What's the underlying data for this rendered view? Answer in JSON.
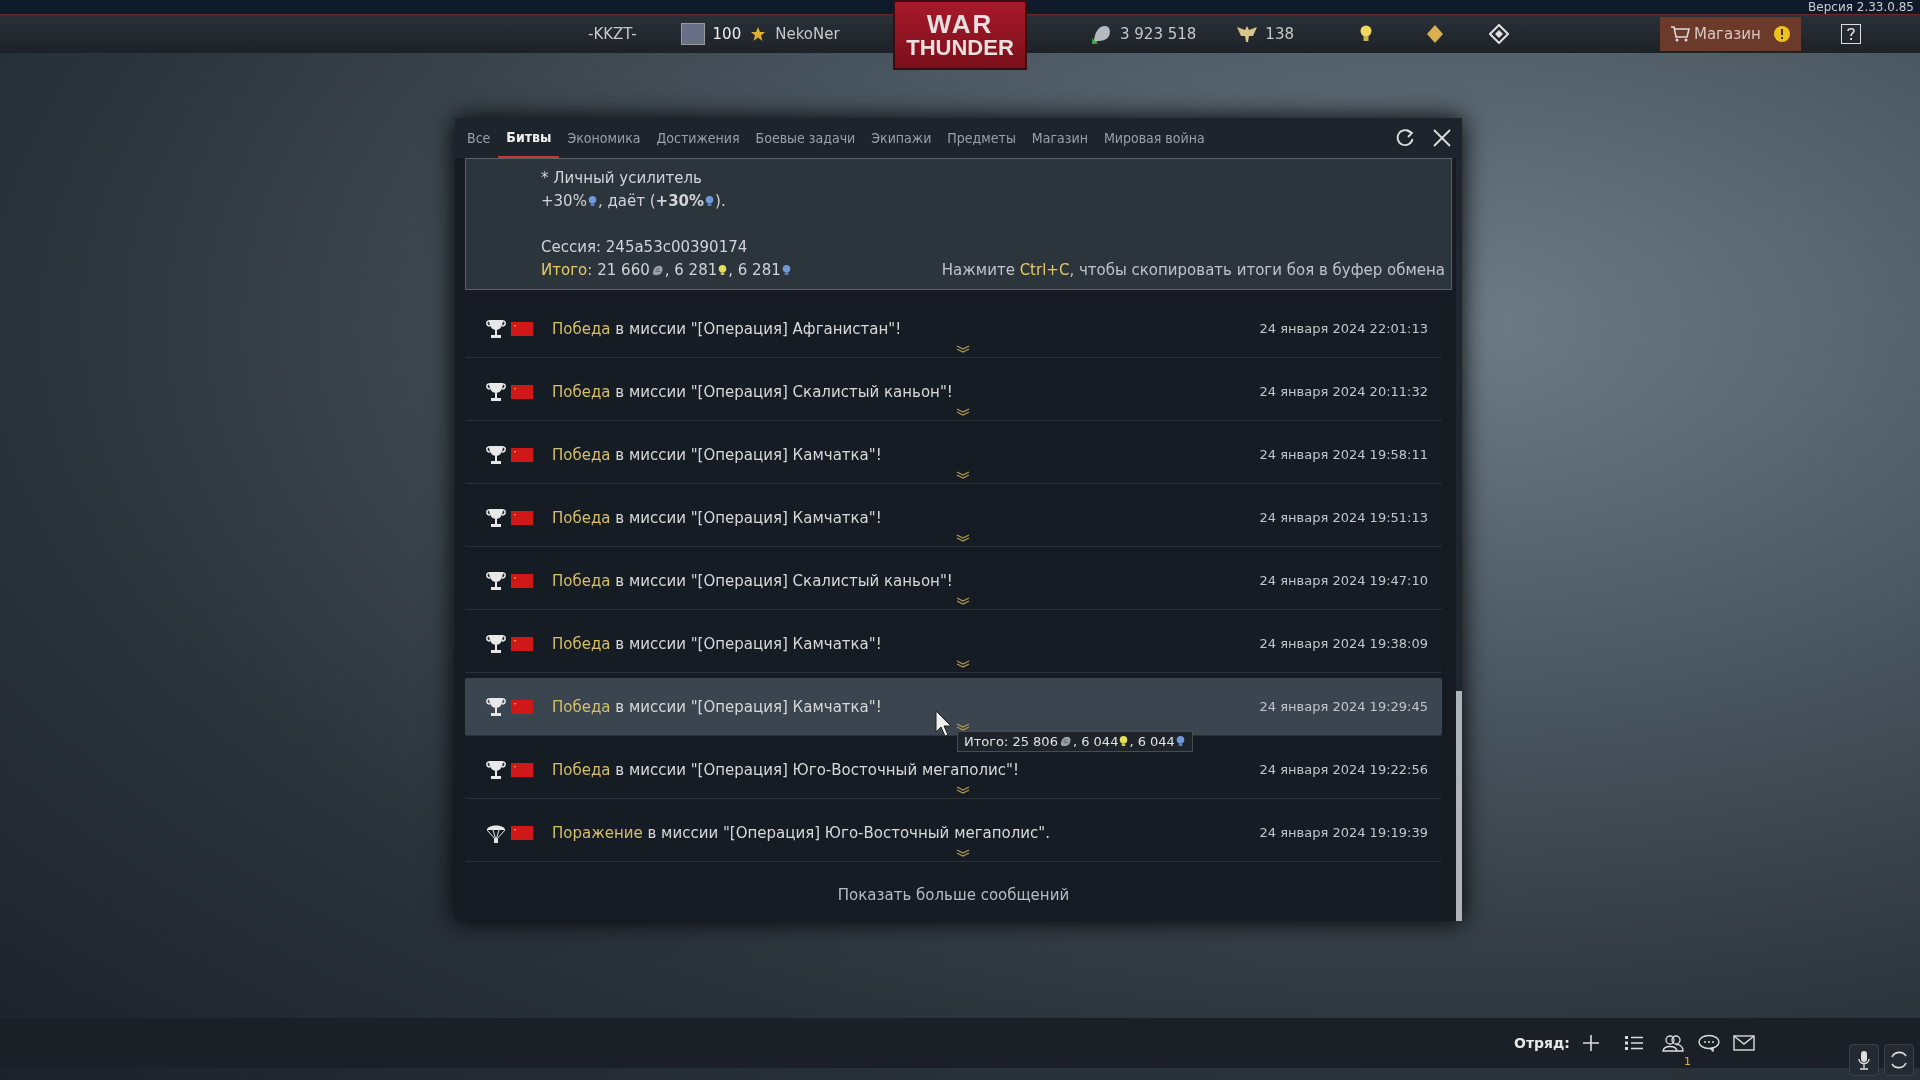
{
  "top_bar": {
    "version": "Версия 2.33.0.85",
    "clan_tag": "-KKZT-",
    "rank": "100",
    "nickname": "NekoNer",
    "logo": {
      "line_1": "WAR",
      "line_2": "THUNDER"
    },
    "silver": "3 923 518",
    "gold": "138",
    "shop": "Магазин"
  },
  "dialog": {
    "tabs": [
      {
        "label": "Все",
        "selected": false
      },
      {
        "label": "Битвы",
        "selected": true
      },
      {
        "label": "Экономика",
        "selected": false
      },
      {
        "label": "Достижения",
        "selected": false
      },
      {
        "label": "Боевые задачи",
        "selected": false
      },
      {
        "label": "Экипажи",
        "selected": false
      },
      {
        "label": "Предметы",
        "selected": false
      },
      {
        "label": "Магазин",
        "selected": false
      },
      {
        "label": "Мировая война",
        "selected": false
      }
    ],
    "summary": {
      "lines": [
        [
          {
            "text": "* Личный усилитель"
          }
        ],
        [
          {
            "text": "+30%",
            "kind": "rp"
          },
          {
            "text": ", даёт ("
          },
          {
            "text": "+30%",
            "kind": "rp",
            "bold": true
          },
          {
            "text": ")."
          }
        ]
      ],
      "session": "Сессия: 245a53c00390174",
      "total": {
        "label": "Итого:",
        "parts": [
          {
            "text": "21 660",
            "kind": "silver"
          },
          {
            "text": ", 6 281",
            "kind": "bulb"
          },
          {
            "text": ", 6 281",
            "kind": "rp"
          }
        ]
      },
      "hint": {
        "before": "Нажмите ",
        "key": "Ctrl+C",
        "after": ", чтобы скопировать итоги боя в буфер обмена"
      }
    },
    "rows": [
      {
        "kind": "victory",
        "result": "Победа",
        "text": " в миссии \"[Операция] Афганистан\"!",
        "time": "24 января 2024 22:01:13",
        "selected": false
      },
      {
        "kind": "victory",
        "result": "Победа",
        "text": " в миссии \"[Операция] Скалистый каньон\"!",
        "time": "24 января 2024 20:11:32",
        "selected": false
      },
      {
        "kind": "victory",
        "result": "Победа",
        "text": " в миссии \"[Операция] Камчатка\"!",
        "time": "24 января 2024 19:58:11",
        "selected": false
      },
      {
        "kind": "victory",
        "result": "Победа",
        "text": " в миссии \"[Операция] Камчатка\"!",
        "time": "24 января 2024 19:51:13",
        "selected": false
      },
      {
        "kind": "victory",
        "result": "Победа",
        "text": " в миссии \"[Операция] Скалистый каньон\"!",
        "time": "24 января 2024 19:47:10",
        "selected": false
      },
      {
        "kind": "victory",
        "result": "Победа",
        "text": " в миссии \"[Операция] Камчатка\"!",
        "time": "24 января 2024 19:38:09",
        "selected": false
      },
      {
        "kind": "victory",
        "result": "Победа",
        "text": " в миссии \"[Операция] Камчатка\"!",
        "time": "24 января 2024 19:29:45",
        "selected": true
      },
      {
        "kind": "victory",
        "result": "Победа",
        "text": " в миссии \"[Операция] Юго-Восточный мегаполис\"!",
        "time": "24 января 2024 19:22:56",
        "selected": false
      },
      {
        "kind": "defeat",
        "result": "Поражение",
        "text": " в миссии \"[Операция] Юго-Восточный мегаполис\".",
        "time": "24 января 2024 19:19:39",
        "selected": false
      }
    ],
    "tooltip": {
      "label": "Итого:",
      "parts": [
        {
          "text": "25 806",
          "kind": "silver"
        },
        {
          "text": ", 6 044",
          "kind": "bulb"
        },
        {
          "text": ", 6 044",
          "kind": "rp"
        }
      ]
    },
    "show_more": "Показать больше сообщений"
  },
  "bottom_bar": {
    "squad_label": "Отряд:",
    "friends_count": "1"
  }
}
